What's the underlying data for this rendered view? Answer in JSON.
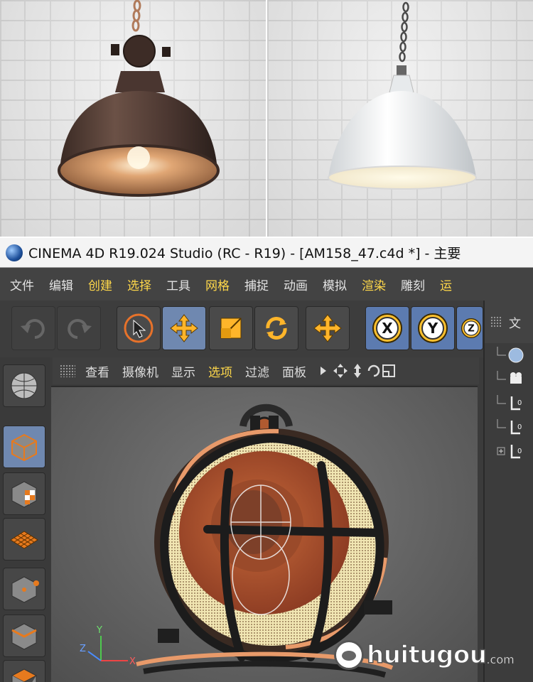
{
  "window": {
    "title": "CINEMA 4D R19.024 Studio (RC - R19) - [AM158_47.c4d *] - 主要"
  },
  "menu": {
    "items": [
      "文件",
      "编辑",
      "创建",
      "选择",
      "工具",
      "网格",
      "捕捉",
      "动画",
      "模拟",
      "渲染",
      "雕刻",
      "运"
    ],
    "highlighted": [
      2,
      3,
      5,
      9,
      11
    ]
  },
  "toolbar": {
    "buttons": [
      {
        "icon": "undo-icon"
      },
      {
        "icon": "redo-icon"
      },
      {
        "icon": "live-selection-icon"
      },
      {
        "icon": "move-icon"
      },
      {
        "icon": "scale-icon"
      },
      {
        "icon": "rotate-icon"
      },
      {
        "icon": "move-tool-icon"
      },
      {
        "icon": "x-axis-icon",
        "label": "X"
      },
      {
        "icon": "y-axis-icon",
        "label": "Y"
      },
      {
        "icon": "z-axis-icon",
        "label": "Z"
      }
    ]
  },
  "viewport_menu": {
    "items": [
      "查看",
      "摄像机",
      "显示",
      "选项",
      "过滤",
      "面板"
    ],
    "highlighted": [
      3
    ]
  },
  "object_manager": {
    "header": "文"
  },
  "axis_labels": {
    "x": "X",
    "y": "Y",
    "z": "Z"
  },
  "watermark": {
    "brand": "huitugou",
    "domain": ".com"
  },
  "colors": {
    "accent_yellow": "#ffd84a",
    "active_blue": "#6f88b0",
    "ui_dark": "#3b3b3b"
  }
}
